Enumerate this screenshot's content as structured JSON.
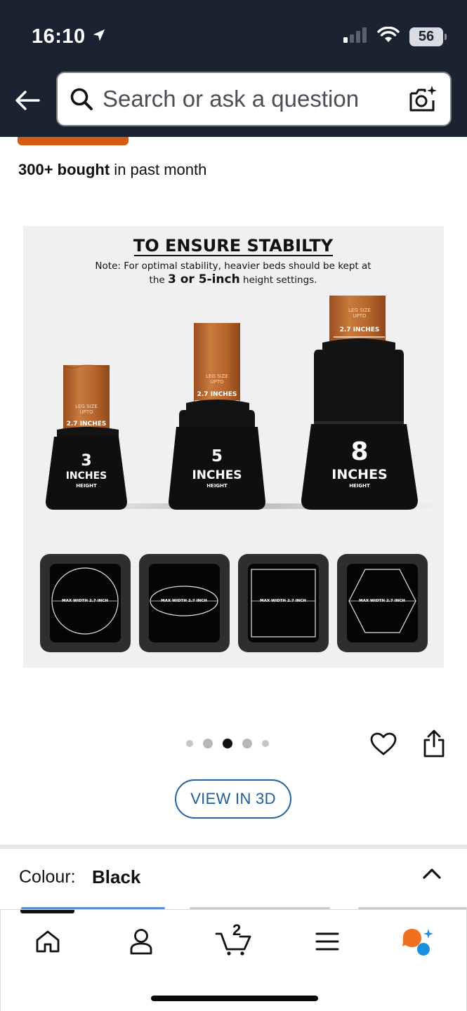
{
  "status_bar": {
    "time": "16:10",
    "battery": "56",
    "icons": [
      "location-arrow-icon",
      "cellular-signal-icon",
      "wifi-icon",
      "battery-icon"
    ]
  },
  "header": {
    "back_icon": "back-arrow-icon",
    "search_placeholder": "Search or ask a question",
    "camera_icon": "camera-search-icon"
  },
  "product": {
    "bought_count": "300+ bought",
    "bought_suffix": " in past month"
  },
  "product_image": {
    "title": "TO ENSURE STABILTY",
    "note_line1": "Note: For optimal stability, heavier beds should be kept at",
    "note_line2_prefix": "the ",
    "note_line2_bold": "3 or 5-inch",
    "note_line2_suffix": " height settings.",
    "risers": [
      {
        "number": "3",
        "unit": "INCHES",
        "sub": "HEIGHT",
        "leg_label_1": "LEG SIZE",
        "leg_label_2": "UPTO",
        "leg_size": "2.7 INCHES"
      },
      {
        "number": "5",
        "unit": "INCHES",
        "sub": "HEIGHT",
        "leg_label_1": "LEG SIZE",
        "leg_label_2": "UPTO",
        "leg_size": "2.7 INCHES"
      },
      {
        "number": "8",
        "unit": "INCHES",
        "sub": "HEIGHT",
        "leg_label_1": "LEG SIZE",
        "leg_label_2": "UPTO",
        "leg_size": "2.7 INCHES"
      }
    ],
    "shapes": [
      {
        "shape": "circle",
        "label": "MAX WIDTH 2.7 INCH"
      },
      {
        "shape": "ellipse",
        "label": "MAX WIDTH 2.7 INCH"
      },
      {
        "shape": "square",
        "label": "MAX WIDTH 2.7 INCH"
      },
      {
        "shape": "hexagon",
        "label": "MAX WIDTH 2.7 INCH"
      }
    ]
  },
  "carousel": {
    "dot_count": 5,
    "active_index": 2
  },
  "actions": {
    "wishlist_icon": "heart-icon",
    "share_icon": "share-icon",
    "view_3d": "VIEW IN 3D"
  },
  "colour": {
    "label": "Colour:",
    "value": "Black",
    "toggle_icon": "chevron-up-icon"
  },
  "tabbar": {
    "items": [
      {
        "icon": "home-icon"
      },
      {
        "icon": "account-icon"
      },
      {
        "icon": "cart-icon",
        "count": "2"
      },
      {
        "icon": "menu-icon"
      },
      {
        "icon": "rufus-assistant-icon"
      }
    ],
    "colors": {
      "assistant_orange": "#f0701f",
      "assistant_blue": "#1b8fe0"
    }
  },
  "colors": {
    "header_bg": "#1b2230",
    "accent_orange": "#d35b16",
    "link_blue": "#2162a1"
  }
}
